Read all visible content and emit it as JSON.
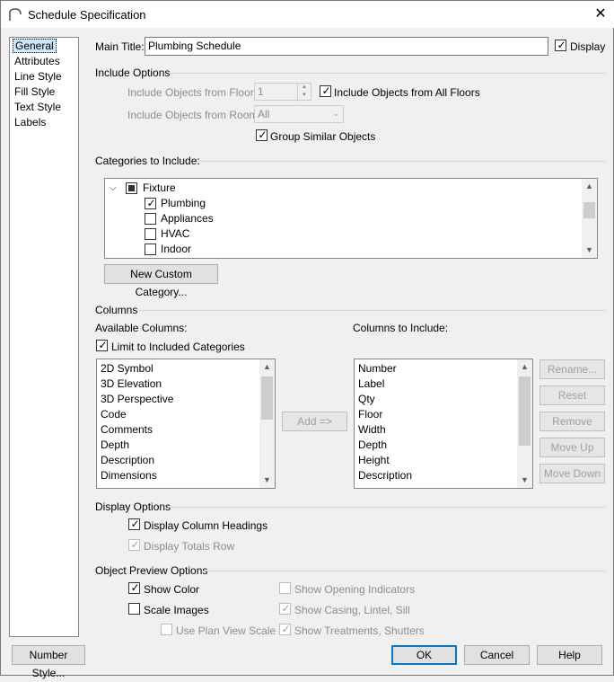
{
  "window": {
    "title": "Schedule Specification",
    "close_icon": "close-icon"
  },
  "nav": {
    "items": [
      {
        "label": "General",
        "selected": true
      },
      {
        "label": "Attributes"
      },
      {
        "label": "Line Style"
      },
      {
        "label": "Fill Style"
      },
      {
        "label": "Text Style"
      },
      {
        "label": "Labels"
      }
    ]
  },
  "main_title": {
    "label": "Main Title:",
    "value": "Plumbing Schedule",
    "display_label": "Display",
    "display_checked": true
  },
  "include_options": {
    "heading": "Include Options",
    "floor_label": "Include Objects from Floor:",
    "floor_value": "1",
    "all_floors_label": "Include Objects from All Floors",
    "all_floors_checked": true,
    "room_label": "Include Objects from Room:",
    "room_value": "All",
    "group_similar_label": "Group Similar Objects",
    "group_similar_checked": true
  },
  "categories": {
    "heading": "Categories to Include:",
    "parent": "Fixture",
    "items": [
      {
        "label": "Plumbing",
        "checked": true
      },
      {
        "label": "Appliances",
        "checked": false
      },
      {
        "label": "HVAC",
        "checked": false
      },
      {
        "label": "Indoor",
        "checked": false
      }
    ],
    "new_button": "New Custom Category..."
  },
  "columns": {
    "heading": "Columns",
    "available_label": "Available Columns:",
    "limit_label": "Limit to Included Categories",
    "limit_checked": true,
    "available": [
      "2D Symbol",
      "3D Elevation",
      "3D Perspective",
      "Code",
      "Comments",
      "Depth",
      "Description",
      "Dimensions"
    ],
    "add_button": "Add =>",
    "include_label": "Columns to Include:",
    "included": [
      "Number",
      "Label",
      "Qty",
      "Floor",
      "Width",
      "Depth",
      "Height",
      "Description"
    ],
    "buttons": {
      "rename": "Rename...",
      "reset": "Reset",
      "remove": "Remove",
      "move_up": "Move Up",
      "move_down": "Move Down"
    }
  },
  "display_options": {
    "heading": "Display Options",
    "column_headings_label": "Display Column Headings",
    "column_headings_checked": true,
    "totals_label": "Display Totals Row",
    "totals_checked": true
  },
  "preview_options": {
    "heading": "Object Preview Options",
    "show_color_label": "Show Color",
    "show_color_checked": true,
    "scale_images_label": "Scale Images",
    "scale_images_checked": false,
    "plan_view_scale_label": "Use Plan View Scale",
    "plan_view_scale_checked": false,
    "opening_indicators_label": "Show Opening Indicators",
    "opening_indicators_checked": false,
    "casing_label": "Show Casing, Lintel, Sill",
    "casing_checked": true,
    "treatments_label": "Show Treatments, Shutters",
    "treatments_checked": true
  },
  "footer": {
    "number_style": "Number Style...",
    "ok": "OK",
    "cancel": "Cancel",
    "help": "Help"
  }
}
